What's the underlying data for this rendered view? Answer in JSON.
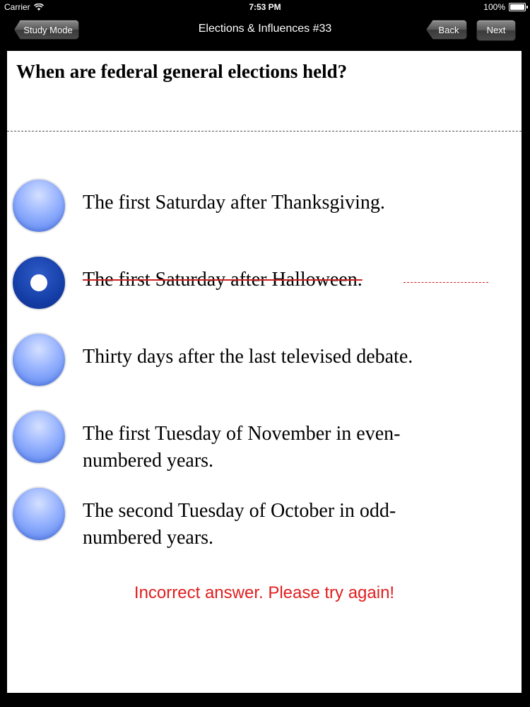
{
  "status_bar": {
    "carrier": "Carrier",
    "time": "7:53 PM",
    "battery": "100%"
  },
  "nav": {
    "title": "Elections & Influences #33",
    "study_mode_label": "Study Mode",
    "back_label": "Back",
    "next_label": "Next"
  },
  "question": "When are federal general elections held?",
  "options": [
    {
      "text": "The first Saturday after Thanksgiving.",
      "selected": false,
      "struck": false
    },
    {
      "text": "The first Saturday after Halloween.",
      "selected": true,
      "struck": true
    },
    {
      "text": "Thirty days after the last televised debate.",
      "selected": false,
      "struck": false
    },
    {
      "text": "The first Tuesday of November in even-numbered years.",
      "selected": false,
      "struck": false
    },
    {
      "text": "The second Tuesday of October in odd-numbered years.",
      "selected": false,
      "struck": false
    }
  ],
  "feedback": "Incorrect answer. Please try again!",
  "colors": {
    "feedback": "#e01e1e",
    "radio": "#7a9ef7",
    "radio_selected": "#153fa8"
  }
}
